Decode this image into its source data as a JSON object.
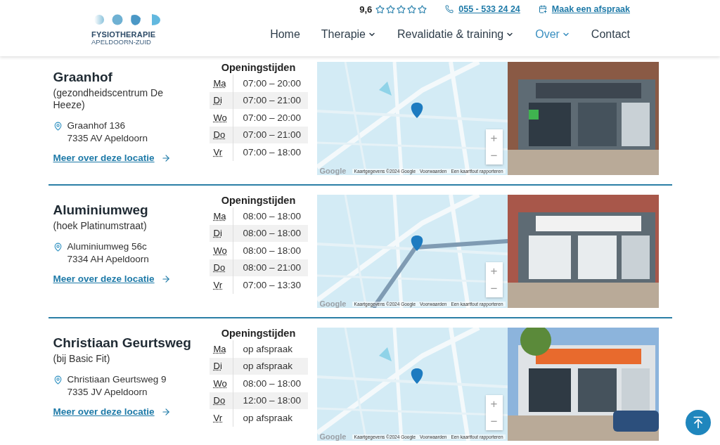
{
  "header": {
    "logo": {
      "line1": "FYSIOTHERAPIE",
      "line2": "APELDOORN-ZUID"
    },
    "rating": {
      "score": "9,6",
      "stars": 0
    },
    "phone": "055 - 533 24 24",
    "appointment": "Maak een afspraak",
    "nav": [
      {
        "label": "Home",
        "dropdown": false,
        "selected": false
      },
      {
        "label": "Therapie",
        "dropdown": true,
        "selected": false
      },
      {
        "label": "Revalidatie & training",
        "dropdown": true,
        "selected": false
      },
      {
        "label": "Over",
        "dropdown": true,
        "selected": true
      },
      {
        "label": "Contact",
        "dropdown": false,
        "selected": false
      }
    ]
  },
  "locations": [
    {
      "name": "Graanhof",
      "subtitle": "(gezondheidscentrum De Heeze)",
      "street": "Graanhof 136",
      "city": "7335 AV Apeldoorn",
      "link": "Meer over deze locatie",
      "hours_title": "Openingstijden",
      "hours": [
        {
          "day": "Ma",
          "time": "07:00 – 20:00"
        },
        {
          "day": "Di",
          "time": "07:00 – 21:00"
        },
        {
          "day": "Wo",
          "time": "07:00 – 20:00"
        },
        {
          "day": "Do",
          "time": "07:00 – 21:00"
        },
        {
          "day": "Vr",
          "time": "07:00 – 18:00"
        }
      ],
      "map": {
        "logo": "Google",
        "attribution": "Kaartgegevens ©2024 Google",
        "terms": "Voorwaarden",
        "report": "Een kaartfout rapporteren",
        "zoom_in": "+",
        "zoom_out": "−"
      }
    },
    {
      "name": "Aluminiumweg",
      "subtitle": "(hoek Platinumstraat)",
      "street": "Aluminiumweg 56c",
      "city": "7334 AH Apeldoorn",
      "link": "Meer over deze locatie",
      "hours_title": "Openingstijden",
      "hours": [
        {
          "day": "Ma",
          "time": "08:00 – 18:00"
        },
        {
          "day": "Di",
          "time": "08:00 – 18:00"
        },
        {
          "day": "Wo",
          "time": "08:00 – 18:00"
        },
        {
          "day": "Do",
          "time": "08:00 – 21:00"
        },
        {
          "day": "Vr",
          "time": "07:00 – 13:30"
        }
      ],
      "map": {
        "logo": "Google",
        "attribution": "Kaartgegevens ©2024 Google",
        "terms": "Voorwaarden",
        "report": "Een kaartfout rapporteren",
        "zoom_in": "+",
        "zoom_out": "−"
      }
    },
    {
      "name": "Christiaan Geurtsweg",
      "subtitle": "(bij Basic Fit)",
      "street": "Christiaan Geurtsweg 9",
      "city": "7335 JV Apeldoorn",
      "link": "Meer over deze locatie",
      "hours_title": "Openingstijden",
      "hours": [
        {
          "day": "Ma",
          "time": "op afspraak"
        },
        {
          "day": "Di",
          "time": "op afspraak"
        },
        {
          "day": "Wo",
          "time": "08:00 – 18:00"
        },
        {
          "day": "Do",
          "time": "12:00 – 18:00"
        },
        {
          "day": "Vr",
          "time": "op afspraak"
        }
      ],
      "map": {
        "logo": "Google",
        "attribution": "Kaartgegevens ©2024 Google",
        "terms": "Voorwaarden",
        "report": "Een kaartfout rapporteren",
        "zoom_in": "+",
        "zoom_out": "−"
      }
    }
  ]
}
